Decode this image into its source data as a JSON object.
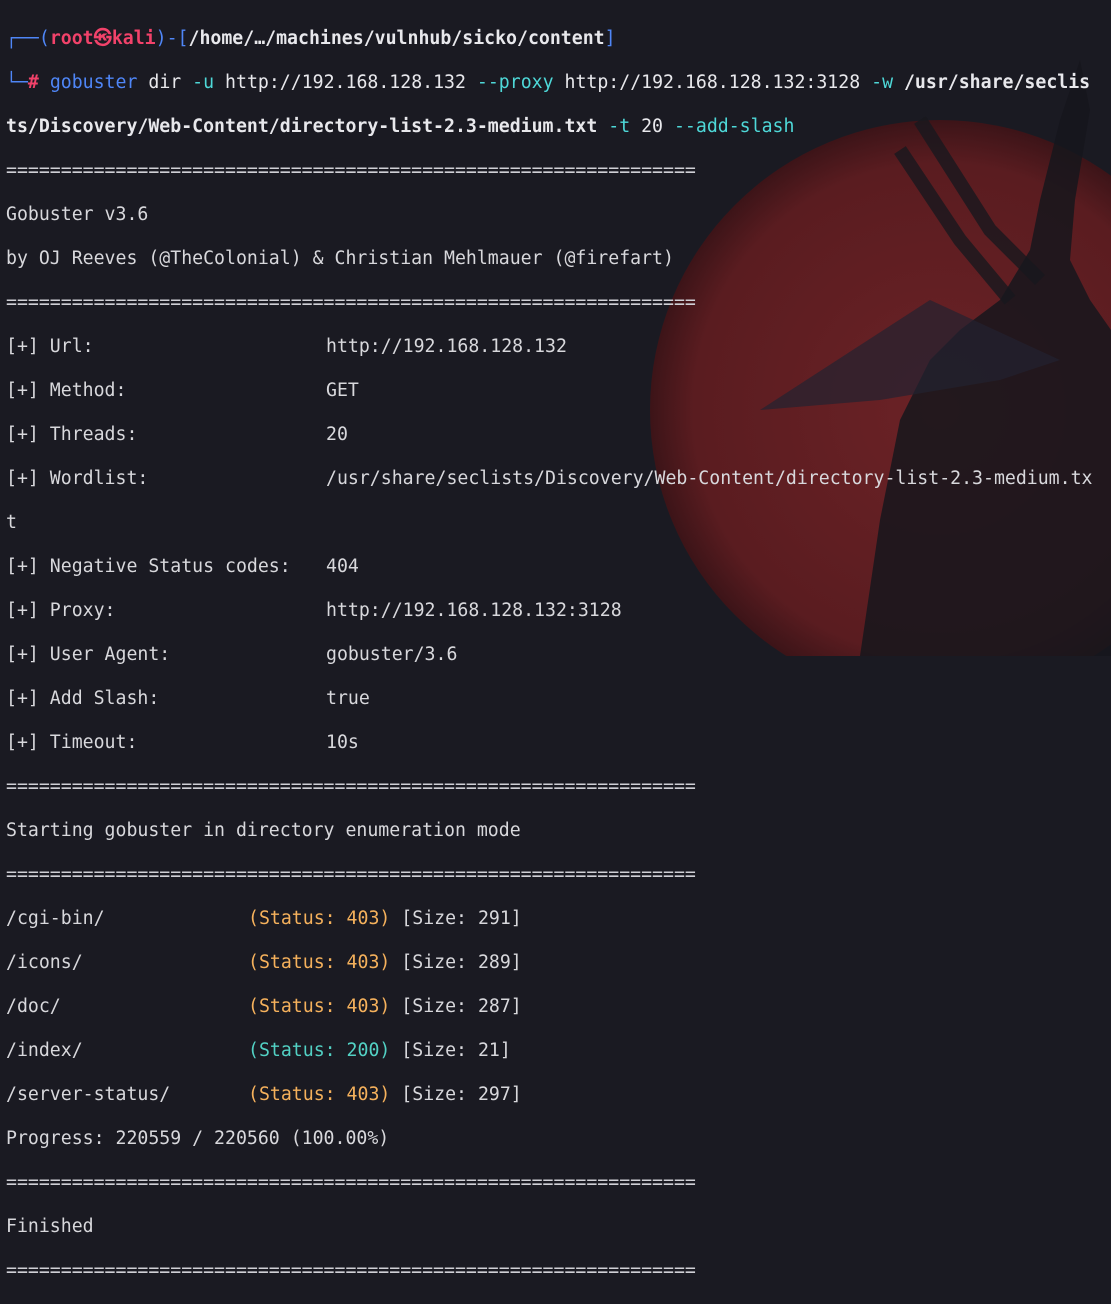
{
  "prompt": {
    "corner_top": "┌──(",
    "user": "root",
    "at": "㉿",
    "host": "kali",
    "sep1": ")-[",
    "cwd": "/home/…/machines/vulnhub/sicko/content",
    "sep2": "]",
    "corner_bottom": "└─",
    "symbol": "#"
  },
  "command": {
    "program": "gobuster",
    "sub": " dir",
    "flag_u": " -u",
    "url": " http://192.168.128.132",
    "flag_proxy": " --proxy",
    "proxy": " http://192.168.128.132:3128",
    "flag_w": " -w",
    "wordlist_part1": " /usr/share/seclis",
    "wordlist_part2": "ts/Discovery/Web-Content/directory-list-2.3-medium.txt",
    "flag_t": " -t",
    "threads": " 20",
    "flag_slash": " --add-slash"
  },
  "separator": "===============================================================",
  "banner": {
    "version": "Gobuster v3.6",
    "authors": "by OJ Reeves (@TheColonial) & Christian Mehlmauer (@firefart)"
  },
  "config": [
    {
      "label": "[+] Url:",
      "value": "http://192.168.128.132"
    },
    {
      "label": "[+] Method:",
      "value": "GET"
    },
    {
      "label": "[+] Threads:",
      "value": "20"
    },
    {
      "label": "[+] Wordlist:",
      "value": "/usr/share/seclists/Discovery/Web-Content/directory-list-2.3-medium.tx"
    },
    {
      "label": "t",
      "value": ""
    },
    {
      "label": "[+] Negative Status codes:",
      "value": "404"
    },
    {
      "label": "[+] Proxy:",
      "value": "http://192.168.128.132:3128"
    },
    {
      "label": "[+] User Agent:",
      "value": "gobuster/3.6"
    },
    {
      "label": "[+] Add Slash:",
      "value": "true"
    },
    {
      "label": "[+] Timeout:",
      "value": "10s"
    }
  ],
  "start_msg": "Starting gobuster in directory enumeration mode",
  "results": [
    {
      "path": "/cgi-bin/",
      "status": "(Status: 403)",
      "size": " [Size: 291]"
    },
    {
      "path": "/icons/",
      "status": "(Status: 403)",
      "size": " [Size: 289]"
    },
    {
      "path": "/doc/",
      "status": "(Status: 403)",
      "size": " [Size: 287]"
    },
    {
      "path": "/index/",
      "status": "(Status: 200)",
      "size": " [Size: 21]"
    },
    {
      "path": "/server-status/",
      "status": "(Status: 403)",
      "size": " [Size: 297]"
    }
  ],
  "progress": "Progress: 220559 / 220560 (100.00%)",
  "finished": "Finished",
  "colors": {
    "background": "#1a1a22",
    "prompt_blue": "#4f86f7",
    "prompt_red": "#f2426a",
    "status_403": "#f5b15c",
    "status_200": "#52d1c4",
    "moon": "#5a1c20"
  }
}
